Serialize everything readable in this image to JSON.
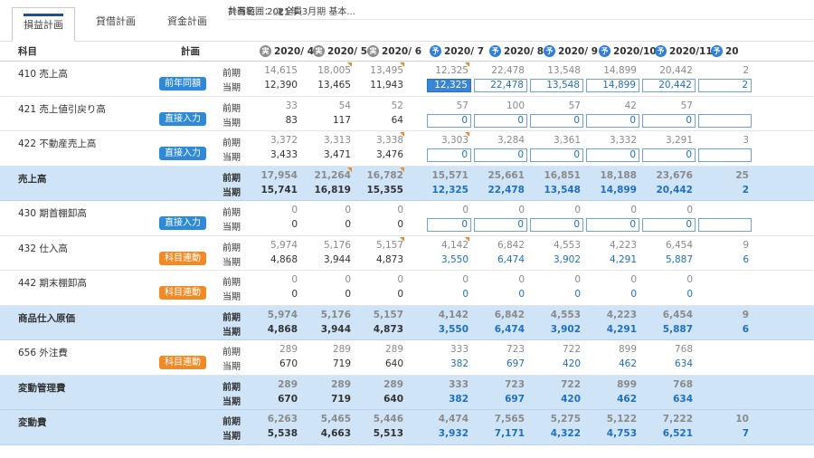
{
  "tabs": [
    {
      "label": "損益計画",
      "active": true
    },
    {
      "label": "貸借計画",
      "active": false
    },
    {
      "label": "資金計画",
      "active": false
    }
  ],
  "plan": {
    "name_label": "計画名",
    "name_value": "：2021年 3月期 基本...",
    "scope_label": "共有範囲：",
    "scope_value": "全員"
  },
  "header": {
    "account": "科目",
    "plan": "計画",
    "months": [
      {
        "label": "2020/ 4",
        "badge": "実",
        "kind": "act"
      },
      {
        "label": "2020/ 5",
        "badge": "実",
        "kind": "act"
      },
      {
        "label": "2020/ 6",
        "badge": "実",
        "kind": "act"
      },
      {
        "label": "2020/ 7",
        "badge": "予",
        "kind": "fc"
      },
      {
        "label": "2020/ 8",
        "badge": "予",
        "kind": "fc"
      },
      {
        "label": "2020/ 9",
        "badge": "予",
        "kind": "fc"
      },
      {
        "label": "2020/10",
        "badge": "予",
        "kind": "fc"
      },
      {
        "label": "2020/11",
        "badge": "予",
        "kind": "fc"
      },
      {
        "label": "20",
        "badge": "予",
        "kind": "fc"
      }
    ]
  },
  "labels": {
    "prev": "前期",
    "cur": "当期"
  },
  "rows": [
    {
      "account": "410 売上高",
      "method": "前年同額",
      "color": "blue",
      "sum": false,
      "inputs": true,
      "sel": 3,
      "prev": [
        "14,615",
        "18,005",
        "13,495",
        "12,325",
        "22,478",
        "13,548",
        "14,899",
        "20,442",
        "2"
      ],
      "cur": [
        "12,390",
        "13,465",
        "11,943",
        "12,325",
        "22,478",
        "13,548",
        "14,899",
        "20,442",
        "2"
      ],
      "tri": [
        1,
        2,
        3
      ]
    },
    {
      "account": "421 売上値引戻り高",
      "method": "直接入力",
      "color": "blue",
      "sum": false,
      "inputs": true,
      "prev": [
        "33",
        "54",
        "52",
        "57",
        "100",
        "57",
        "42",
        "57",
        ""
      ],
      "cur": [
        "83",
        "117",
        "64",
        "0",
        "0",
        "0",
        "0",
        "0",
        ""
      ],
      "tri": []
    },
    {
      "account": "422 不動産売上高",
      "method": "直接入力",
      "color": "blue",
      "sum": false,
      "inputs": true,
      "prev": [
        "3,372",
        "3,313",
        "3,338",
        "3,303",
        "3,284",
        "3,361",
        "3,332",
        "3,291",
        "3"
      ],
      "cur": [
        "3,433",
        "3,471",
        "3,476",
        "0",
        "0",
        "0",
        "0",
        "0",
        ""
      ],
      "tri": [
        2,
        3
      ]
    },
    {
      "account": "売上高",
      "method": "",
      "sum": true,
      "inputs": false,
      "prev": [
        "17,954",
        "21,264",
        "16,782",
        "15,571",
        "25,661",
        "16,851",
        "18,188",
        "23,676",
        "25"
      ],
      "cur": [
        "15,741",
        "16,819",
        "15,355",
        "12,325",
        "22,478",
        "13,548",
        "14,899",
        "20,442",
        "2"
      ],
      "tri": [
        1,
        2
      ]
    },
    {
      "account": "430 期首棚卸高",
      "method": "直接入力",
      "color": "blue",
      "sum": false,
      "inputs": true,
      "prev": [
        "0",
        "0",
        "0",
        "0",
        "0",
        "0",
        "0",
        "0",
        ""
      ],
      "cur": [
        "0",
        "0",
        "0",
        "0",
        "0",
        "0",
        "0",
        "0",
        ""
      ],
      "tri": []
    },
    {
      "account": "432 仕入高",
      "method": "科目連動",
      "color": "orange",
      "sum": false,
      "inputs": false,
      "prev": [
        "5,974",
        "5,176",
        "5,157",
        "4,142",
        "6,842",
        "4,553",
        "4,223",
        "6,454",
        "9"
      ],
      "cur": [
        "4,868",
        "3,944",
        "4,873",
        "3,550",
        "6,474",
        "3,902",
        "4,291",
        "5,887",
        "6"
      ],
      "tri": [
        2,
        3
      ]
    },
    {
      "account": "442 期末棚卸高",
      "method": "科目連動",
      "color": "orange",
      "sum": false,
      "inputs": false,
      "prev": [
        "0",
        "0",
        "0",
        "0",
        "0",
        "0",
        "0",
        "0",
        ""
      ],
      "cur": [
        "0",
        "0",
        "0",
        "0",
        "0",
        "0",
        "0",
        "0",
        ""
      ],
      "tri": []
    },
    {
      "account": "商品仕入原価",
      "method": "",
      "sum": true,
      "inputs": false,
      "prev": [
        "5,974",
        "5,176",
        "5,157",
        "4,142",
        "6,842",
        "4,553",
        "4,223",
        "6,454",
        "9"
      ],
      "cur": [
        "4,868",
        "3,944",
        "4,873",
        "3,550",
        "6,474",
        "3,902",
        "4,291",
        "5,887",
        "6"
      ],
      "tri": []
    },
    {
      "account": "656 外注費",
      "method": "科目連動",
      "color": "orange",
      "sum": false,
      "inputs": false,
      "prev": [
        "289",
        "289",
        "289",
        "333",
        "723",
        "722",
        "899",
        "768",
        ""
      ],
      "cur": [
        "670",
        "719",
        "640",
        "382",
        "697",
        "420",
        "462",
        "634",
        ""
      ],
      "tri": []
    },
    {
      "account": "変動管理費",
      "method": "",
      "sum": true,
      "inputs": false,
      "prev": [
        "289",
        "289",
        "289",
        "333",
        "723",
        "722",
        "899",
        "768",
        ""
      ],
      "cur": [
        "670",
        "719",
        "640",
        "382",
        "697",
        "420",
        "462",
        "634",
        ""
      ],
      "tri": []
    },
    {
      "account": "変動費",
      "method": "",
      "sum": true,
      "inputs": false,
      "prev": [
        "6,263",
        "5,465",
        "5,446",
        "4,474",
        "7,565",
        "5,275",
        "5,122",
        "7,222",
        "10"
      ],
      "cur": [
        "5,538",
        "4,663",
        "5,513",
        "3,932",
        "7,171",
        "4,322",
        "4,753",
        "6,521",
        "7"
      ],
      "tri": []
    }
  ]
}
